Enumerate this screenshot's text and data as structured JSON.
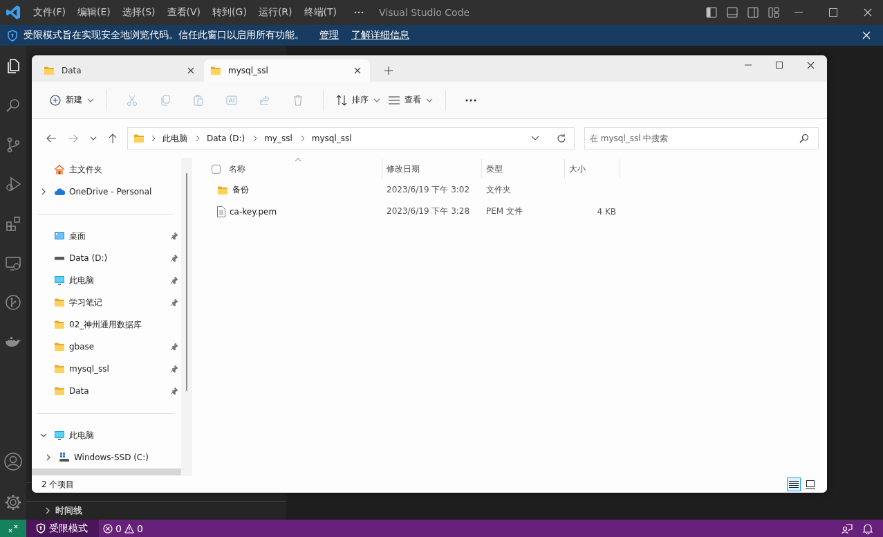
{
  "vscode": {
    "menu": [
      "文件(F)",
      "编辑(E)",
      "选择(S)",
      "查看(V)",
      "转到(G)",
      "运行(R)",
      "终端(T)"
    ],
    "title": "Visual Studio Code",
    "banner": {
      "text": "受限模式旨在实现安全地浏览代码。信任此窗口以启用所有功能。",
      "links": [
        "管理",
        "了解详细信息"
      ]
    },
    "sidebar_sections": [
      {
        "label": "时间线",
        "expanded": false
      }
    ],
    "status_bar": {
      "mode": "受限模式",
      "errors": "0",
      "warnings": "0"
    }
  },
  "explorer": {
    "tabs": [
      {
        "label": "Data",
        "selected": false
      },
      {
        "label": "mysql_ssl",
        "selected": true
      }
    ],
    "toolbar": {
      "new": "新建",
      "sort": "排序",
      "view": "查看"
    },
    "address": {
      "crumbs": [
        "此电脑",
        "Data (D:)",
        "my_ssl",
        "mysql_ssl"
      ]
    },
    "search": {
      "placeholder": "在 mysql_ssl 中搜索"
    },
    "nav": {
      "sections": [
        [
          {
            "label": "主文件夹",
            "kind": "home",
            "pinned": false
          },
          {
            "label": "OneDrive - Personal",
            "kind": "cloud",
            "pinned": false,
            "expanded": false
          }
        ],
        [
          {
            "label": "桌面",
            "kind": "desktop",
            "pinned": true
          },
          {
            "label": "Data (D:)",
            "kind": "drive",
            "pinned": true
          },
          {
            "label": "此电脑",
            "kind": "pc",
            "pinned": true
          },
          {
            "label": "学习笔记",
            "kind": "folder",
            "pinned": true
          },
          {
            "label": "02_神州通用数据库",
            "kind": "folder",
            "pinned": false
          },
          {
            "label": "gbase",
            "kind": "folder",
            "pinned": true
          },
          {
            "label": "mysql_ssl",
            "kind": "folder",
            "pinned": true
          },
          {
            "label": "Data",
            "kind": "folder",
            "pinned": true
          }
        ],
        [
          {
            "label": "此电脑",
            "kind": "pc",
            "pinned": false,
            "expanded": true,
            "children": [
              {
                "label": "Windows-SSD (C:)",
                "kind": "ssd",
                "pinned": false,
                "expanded": false
              }
            ]
          }
        ]
      ]
    },
    "table": {
      "select_all": {
        "checked": false
      },
      "columns": [
        "名称",
        "修改日期",
        "类型",
        "大小"
      ],
      "rows": [
        {
          "name": "备份",
          "kind": "folder",
          "date": "2023/6/19 下午 3:02",
          "type": "文件夹"
        },
        {
          "name": "ca-key.pem",
          "kind": "file",
          "date": "2023/6/19 下午 3:28",
          "type": "PEM 文件",
          "size": "4 KB"
        }
      ]
    },
    "status": "2 个项目",
    "views": [
      {
        "kind": "details",
        "selected": true
      },
      {
        "kind": "tiles",
        "selected": false
      }
    ]
  }
}
